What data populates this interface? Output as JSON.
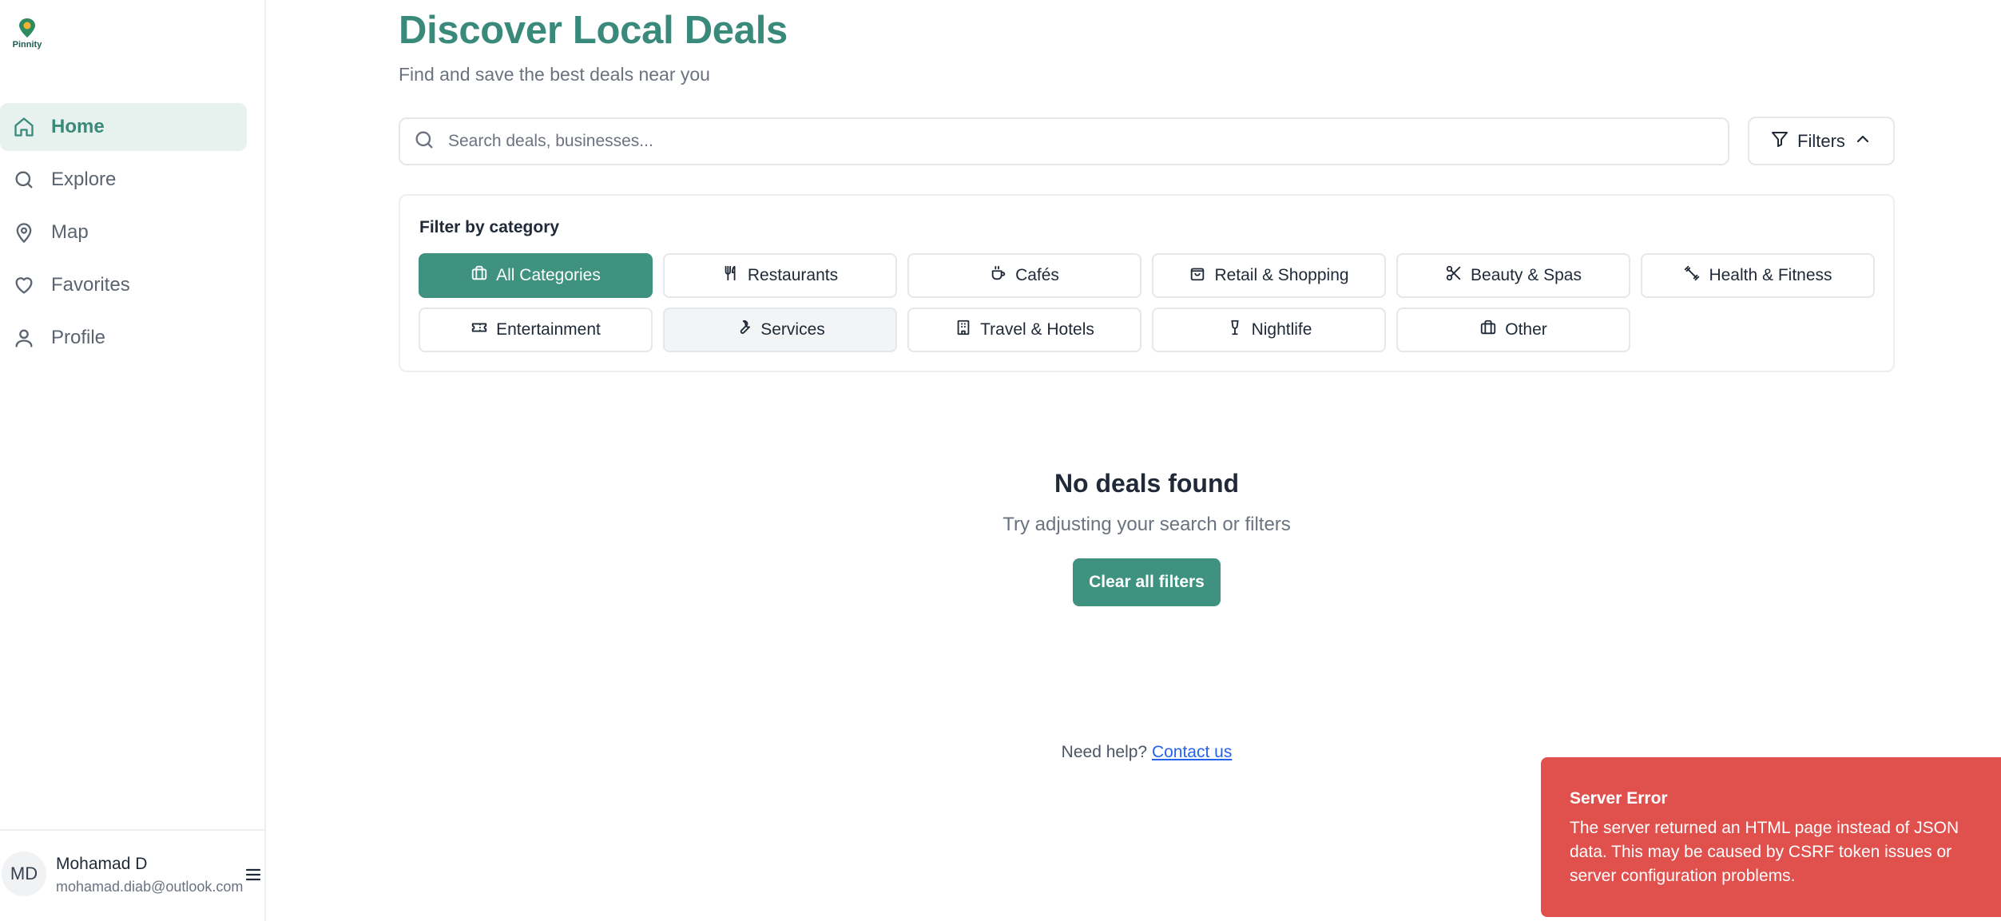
{
  "logo": {
    "text": "Pinnity"
  },
  "sidebar": {
    "items": [
      {
        "label": "Home",
        "icon": "home-icon",
        "active": true
      },
      {
        "label": "Explore",
        "icon": "search-icon",
        "active": false
      },
      {
        "label": "Map",
        "icon": "map-pin-icon",
        "active": false
      },
      {
        "label": "Favorites",
        "icon": "heart-icon",
        "active": false
      },
      {
        "label": "Profile",
        "icon": "user-icon",
        "active": false
      }
    ],
    "user": {
      "initials": "MD",
      "name": "Mohamad D",
      "email": "mohamad.diab@outlook.com"
    }
  },
  "header": {
    "title": "Discover Local Deals",
    "subtitle": "Find and save the best deals near you"
  },
  "search": {
    "placeholder": "Search deals, businesses...",
    "value": ""
  },
  "filters_button": {
    "label": "Filters"
  },
  "categories": {
    "heading": "Filter by category",
    "items": [
      {
        "label": "All Categories",
        "icon": "briefcase-icon"
      },
      {
        "label": "Restaurants",
        "icon": "utensils-icon"
      },
      {
        "label": "Cafés",
        "icon": "coffee-icon"
      },
      {
        "label": "Retail & Shopping",
        "icon": "shopping-bag-icon"
      },
      {
        "label": "Beauty & Spas",
        "icon": "scissors-icon"
      },
      {
        "label": "Health & Fitness",
        "icon": "dumbbell-icon"
      },
      {
        "label": "Entertainment",
        "icon": "ticket-icon"
      },
      {
        "label": "Services",
        "icon": "wrench-icon"
      },
      {
        "label": "Travel & Hotels",
        "icon": "building-icon"
      },
      {
        "label": "Nightlife",
        "icon": "wine-icon"
      },
      {
        "label": "Other",
        "icon": "briefcase-icon"
      }
    ],
    "selected": "All Categories"
  },
  "empty_state": {
    "title": "No deals found",
    "subtitle": "Try adjusting your search or filters",
    "button": "Clear all filters"
  },
  "help": {
    "text": "Need help?",
    "link": "Contact us"
  },
  "toast": {
    "title": "Server Error",
    "message": "The server returned an HTML page instead of JSON data. This may be caused by CSRF token issues or server configuration problems."
  },
  "colors": {
    "brand": "#3a8a7c",
    "button": "#3f9180",
    "error": "#e0504d",
    "link": "#2563eb"
  }
}
